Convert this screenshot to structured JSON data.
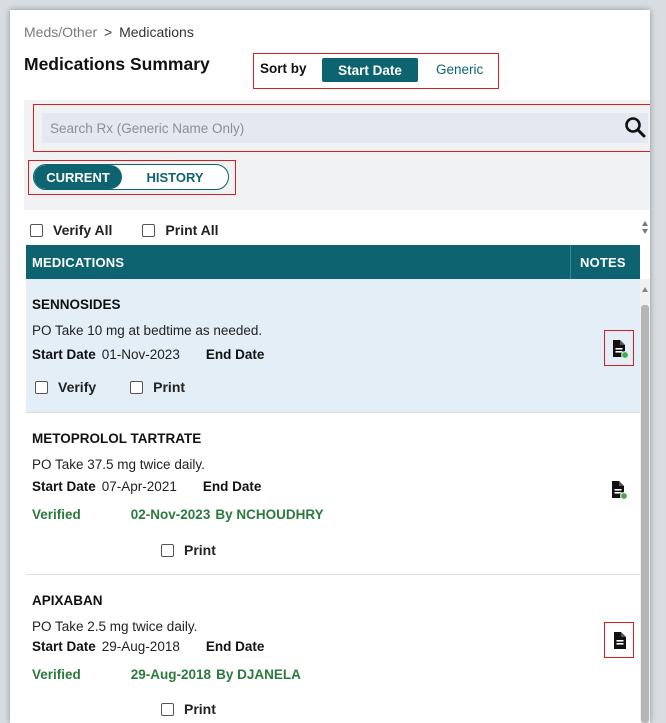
{
  "breadcrumb": {
    "parent": "Meds/Other",
    "separator": ">",
    "current": "Medications"
  },
  "title": "Medications Summary",
  "sort": {
    "label": "Sort by",
    "active": "Start Date",
    "other": "Generic"
  },
  "search": {
    "placeholder": "Search Rx (Generic Name Only)",
    "value": ""
  },
  "tabs": {
    "current": "CURRENT",
    "history": "HISTORY",
    "selected": "CURRENT"
  },
  "bulk": {
    "verify_all": "Verify All",
    "print_all": "Print All"
  },
  "table": {
    "col_medications": "MEDICATIONS",
    "col_notes": "NOTES"
  },
  "labels": {
    "start_date": "Start Date",
    "end_date": "End Date",
    "verify": "Verify",
    "print": "Print",
    "verified": "Verified"
  },
  "medications": [
    {
      "name": "SENNOSIDES",
      "sig": "PO Take 10 mg at bedtime as needed.",
      "start_date": "01-Nov-2023",
      "end_date": "",
      "verified": false
    },
    {
      "name": "METOPROLOL TARTRATE",
      "sig": "PO Take 37.5 mg twice daily.",
      "start_date": "07-Apr-2021",
      "end_date": "",
      "verified": true,
      "verified_date": "02-Nov-2023",
      "verified_by": "By NCHOUDHRY"
    },
    {
      "name": "APIXABAN",
      "sig": "PO Take 2.5 mg twice daily.",
      "start_date": "29-Aug-2018",
      "end_date": "",
      "verified": true,
      "verified_date": "29-Aug-2018",
      "verified_by": "By DJANELA"
    }
  ],
  "colors": {
    "teal": "#0d6470",
    "verified_green": "#2c7a3d",
    "highlight_red": "#d21f1f",
    "note_dot_green": "#3fae49",
    "selected_row": "#e3eef7"
  },
  "icons": {
    "search": "search-icon",
    "note_with_status": "note-document-icon-with-green-dot",
    "note": "note-document-icon"
  }
}
